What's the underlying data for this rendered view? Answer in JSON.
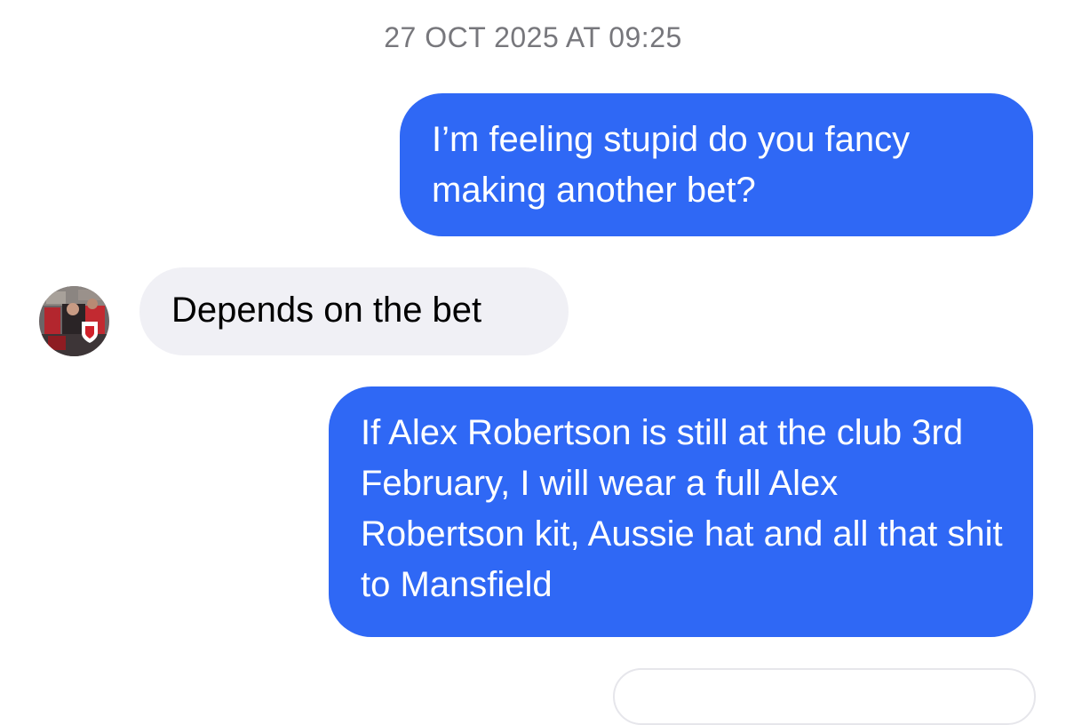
{
  "conversation": {
    "timestamp": "27 OCT 2025 AT 09:25",
    "messages": [
      {
        "direction": "outgoing",
        "text": "I’m feeling stupid do you fancy making another bet?"
      },
      {
        "direction": "incoming",
        "text": "Depends on the bet",
        "avatar": "contact-avatar"
      },
      {
        "direction": "outgoing",
        "text": "If Alex Robertson is still at the club 3rd February, I will wear a full Alex Robertson kit, Aussie hat and all that shit to Mansfield"
      }
    ]
  },
  "colors": {
    "outgoing_bubble": "#2f68f5",
    "incoming_bubble": "#f0f0f5",
    "timestamp_text": "#77777c",
    "background": "#ffffff"
  }
}
